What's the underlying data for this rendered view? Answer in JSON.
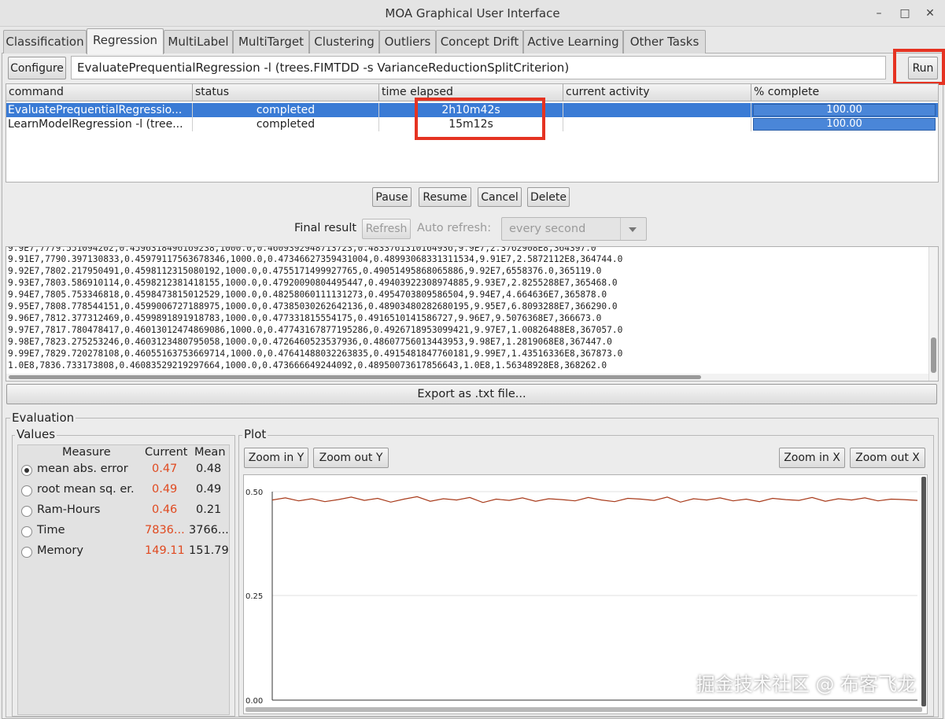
{
  "window": {
    "title": "MOA Graphical User Interface",
    "minimize": "–",
    "maximize": "□",
    "close": "✕"
  },
  "tabs": [
    {
      "label": "Classification"
    },
    {
      "label": "Regression"
    },
    {
      "label": "MultiLabel"
    },
    {
      "label": "MultiTarget"
    },
    {
      "label": "Clustering"
    },
    {
      "label": "Outliers"
    },
    {
      "label": "Concept Drift"
    },
    {
      "label": "Active Learning"
    },
    {
      "label": "Other Tasks"
    }
  ],
  "toolbar": {
    "configure_label": "Configure",
    "command": "EvaluatePrequentialRegression -l (trees.FIMTDD -s VarianceReductionSplitCriterion)",
    "run_label": "Run"
  },
  "table": {
    "columns": [
      "command",
      "status",
      "time elapsed",
      "current activity",
      "% complete"
    ],
    "rows": [
      {
        "command": "EvaluatePrequentialRegressio...",
        "status": "completed",
        "time": "2h10m42s",
        "activity": "",
        "complete": "100.00",
        "progress": 1.0
      },
      {
        "command": "LearnModelRegression -l (tree...",
        "status": "completed",
        "time": "15m12s",
        "activity": "",
        "complete": "100.00",
        "progress": 1.0
      }
    ]
  },
  "actions": {
    "pause": "Pause",
    "resume": "Resume",
    "cancel": "Cancel",
    "delete": "Delete"
  },
  "result_bar": {
    "final_result": "Final result",
    "refresh": "Refresh",
    "auto_refresh": "Auto refresh:",
    "interval": "every second"
  },
  "output_lines": [
    "9.9E7,7779.551094202,0.4596318496169238,1000.0,0.4609392948713723,0.4833761310164936,9.9E7,2.3762908E8,364397.0",
    "9.91E7,7790.397130833,0.4597911756367834​6,1000.0,0.47346627359431004,0.48993068331311534,9.91E7,2.5872112E8,364744.0",
    "9.92E7,7802.217950491,0.4598112315080192,1000.0,0.4755171499927765,0.49051495868065886,9.92E7,6558376.0,365119.0",
    "9.93E7,7803.586910114,0.4598212381418155,1000.0,0.47920090804495447,0.49403922308974885,9.93E7,2.8255288E7,365468.0",
    "9.94E7,7805.753346818,0.4598473815012529,1000.0,0.48258060111131273,0.4954703809586504,9.94E7,4.664636E7,365878.0",
    "9.95E7,7808.778544151,0.4599006727188975,1000.0,0.47385030262642136,0.48903480282680195,9.95E7,6.8093288E7,366290.0",
    "9.96E7,7812.377312469,0.4599891891918783,1000.0,0.4773318155541​75,0.4916510141586727,9.96E7,9.5076368E7,366673.0",
    "9.97E7,7817.780478417,0.46013012474869086,1000.0,0.47743167877195286,0.4926718953099421,9.97E7,1.00826488E8,367057.0",
    "9.98E7,7823.275253246,0.4603123480795058,1000.0,0.4726460523537936,0.48607756013443953,9.98E7,1.2819068E8,367447.0",
    "9.99E7,7829.720278108,0.46055163753669714,1000.0,0.47641488032263835,0.4915481847760181,9.99E7,1.43516336E8,367873.0",
    "1.0E8,7836.733173808,0.46083529219297664,1000.0,0.473666649244092,0.48950073617856643,1.0E8,1.56348928E8,368262.0"
  ],
  "export_label": "Export as .txt file...",
  "evaluation": {
    "title": "Evaluation",
    "values_title": "Values",
    "headers": {
      "measure": "Measure",
      "current": "Current",
      "mean": "Mean"
    },
    "measures": [
      {
        "name": "mean abs. error",
        "current": "0.47",
        "mean": "0.48",
        "selected": true
      },
      {
        "name": "root mean sq. er.",
        "current": "0.49",
        "mean": "0.49",
        "selected": false
      },
      {
        "name": "Ram-Hours",
        "current": "0.46",
        "mean": "0.21",
        "selected": false
      },
      {
        "name": "Time",
        "current": "7836...",
        "mean": "3766...",
        "selected": false
      },
      {
        "name": "Memory",
        "current": "149.11",
        "mean": "151.79",
        "selected": false
      }
    ]
  },
  "plot": {
    "title": "Plot",
    "zoom_in_y": "Zoom in Y",
    "zoom_out_y": "Zoom out Y",
    "zoom_in_x": "Zoom in X",
    "zoom_out_x": "Zoom out X",
    "y_ticks": [
      "0.50",
      "0.25",
      "0.00"
    ]
  },
  "chart_data": {
    "type": "line",
    "ylim": [
      0,
      0.5
    ],
    "series": [
      {
        "values": [
          0.48,
          0.485,
          0.478,
          0.483,
          0.476,
          0.481,
          0.487,
          0.479,
          0.484,
          0.475,
          0.482,
          0.488,
          0.477,
          0.483,
          0.48,
          0.486,
          0.474,
          0.482,
          0.479,
          0.485,
          0.477,
          0.483,
          0.481,
          0.478,
          0.486,
          0.48,
          0.476,
          0.484,
          0.482,
          0.479,
          0.487,
          0.475,
          0.483,
          0.48,
          0.485,
          0.478,
          0.482,
          0.476,
          0.484,
          0.481,
          0.479,
          0.486,
          0.477,
          0.483,
          0.48,
          0.485,
          0.478,
          0.482,
          0.481,
          0.479
        ],
        "color": "#a83a1a"
      }
    ],
    "grid": true
  },
  "colors": {
    "selection": "#3a7bd5",
    "progress": "#4a86d8",
    "current_value": "#e04a20",
    "highlight": "#e53322"
  },
  "watermark": "掘金技术社区 @ 布客飞龙"
}
